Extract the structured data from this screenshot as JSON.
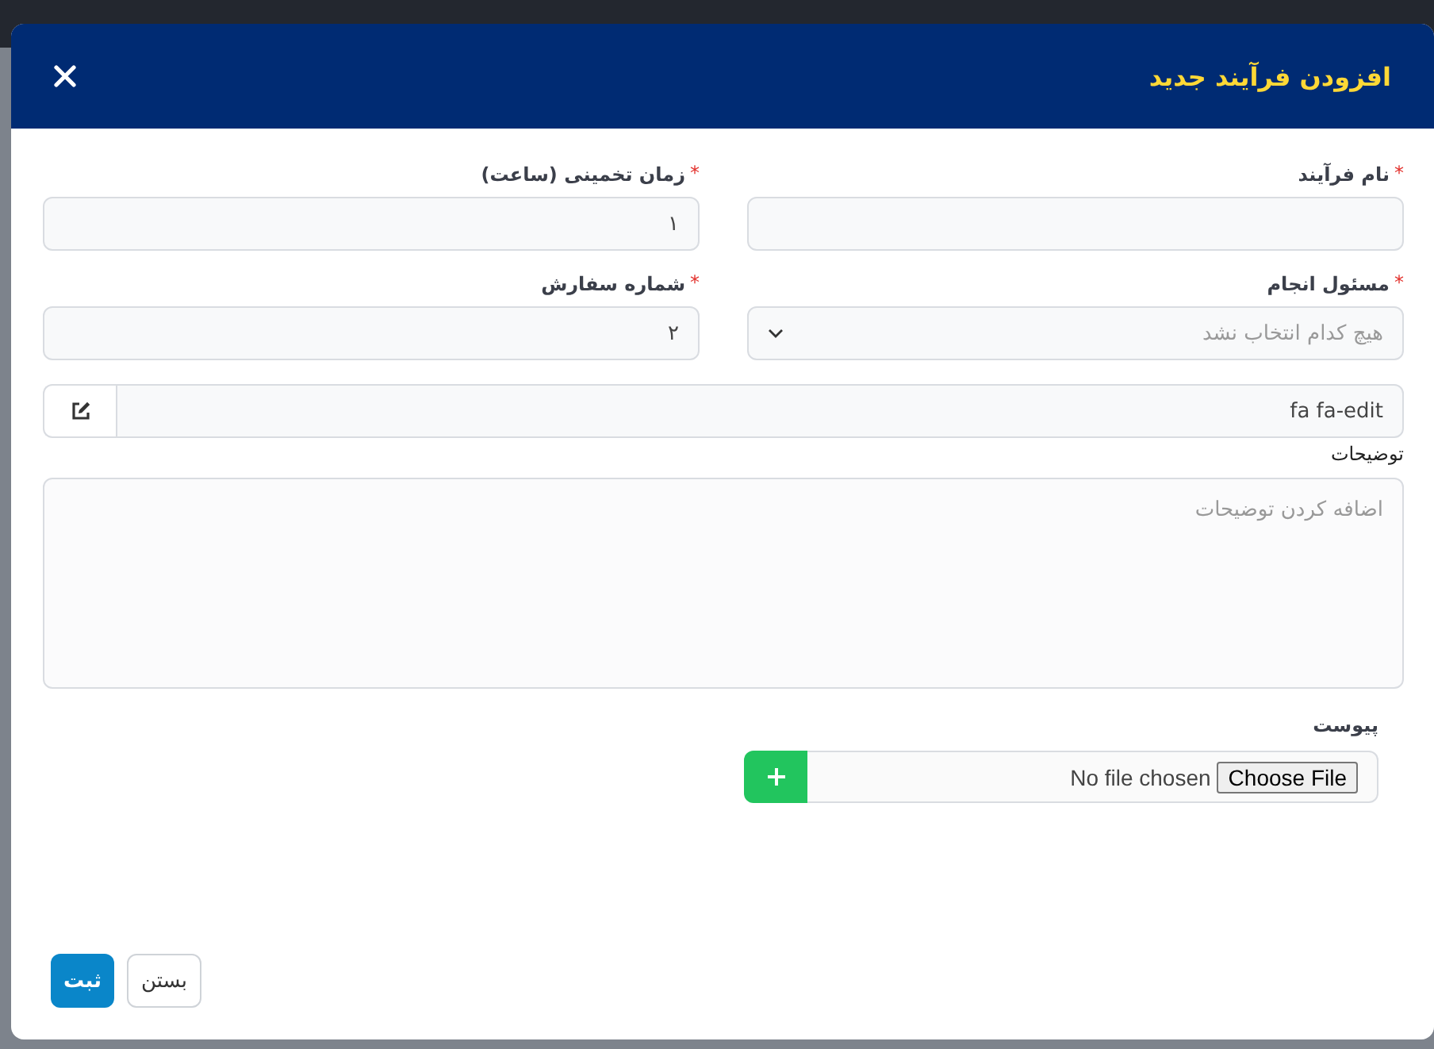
{
  "dialog": {
    "title": "افزودن فرآیند جدید"
  },
  "fields": [
    {
      "kind": "text",
      "label": "نام فرآیند",
      "required_mark": "*"
    },
    {
      "kind": "text",
      "label": "زمان تخمینی (ساعت)",
      "required_mark": "*",
      "value": "۱"
    },
    {
      "kind": "select",
      "label": "مسئول انجام",
      "required_mark": "*",
      "placeholder": "هیچ کدام انتخاب نشد"
    },
    {
      "kind": "text",
      "label": "شماره سفارش",
      "required_mark": "*",
      "value": "۲"
    }
  ],
  "icon_field": {
    "value": "fa fa-edit"
  },
  "description": {
    "label": "توضیحات",
    "placeholder": "اضافه کردن توضیحات"
  },
  "attachment": {
    "label": "پیوست",
    "button": "Choose File",
    "status": "No file chosen"
  },
  "buttons": [
    {
      "label": "بستن",
      "kind": "secondary"
    },
    {
      "label": "ثبت",
      "kind": "primary"
    }
  ]
}
